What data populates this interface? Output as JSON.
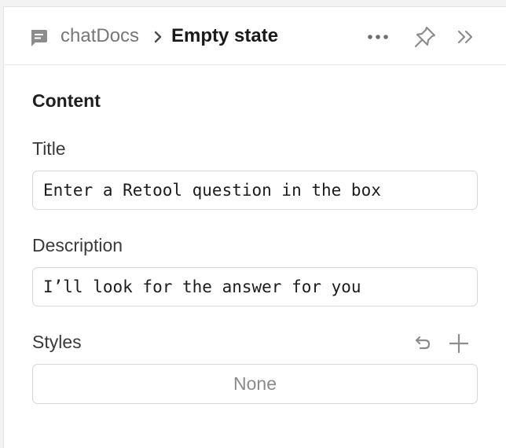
{
  "header": {
    "parent": "chatDocs",
    "current": "Empty state",
    "icons": {
      "component": "chat-bubble-icon",
      "separator": "chevron-right-icon",
      "more": "more-horizontal-icon",
      "pin": "pin-icon",
      "collapse": "double-chevron-right-icon"
    }
  },
  "content": {
    "section_title": "Content",
    "title_label": "Title",
    "title_value": "Enter a Retool question in the box",
    "description_label": "Description",
    "description_value": "I’ll look for the answer for you"
  },
  "styles": {
    "label": "Styles",
    "value": "None",
    "icons": {
      "reset": "reset-icon",
      "add": "plus-icon"
    }
  },
  "colors": {
    "icon": "#8c8c8c",
    "border": "#d6d6d6",
    "text_primary": "#1a1a1a",
    "text_muted": "#777777"
  }
}
